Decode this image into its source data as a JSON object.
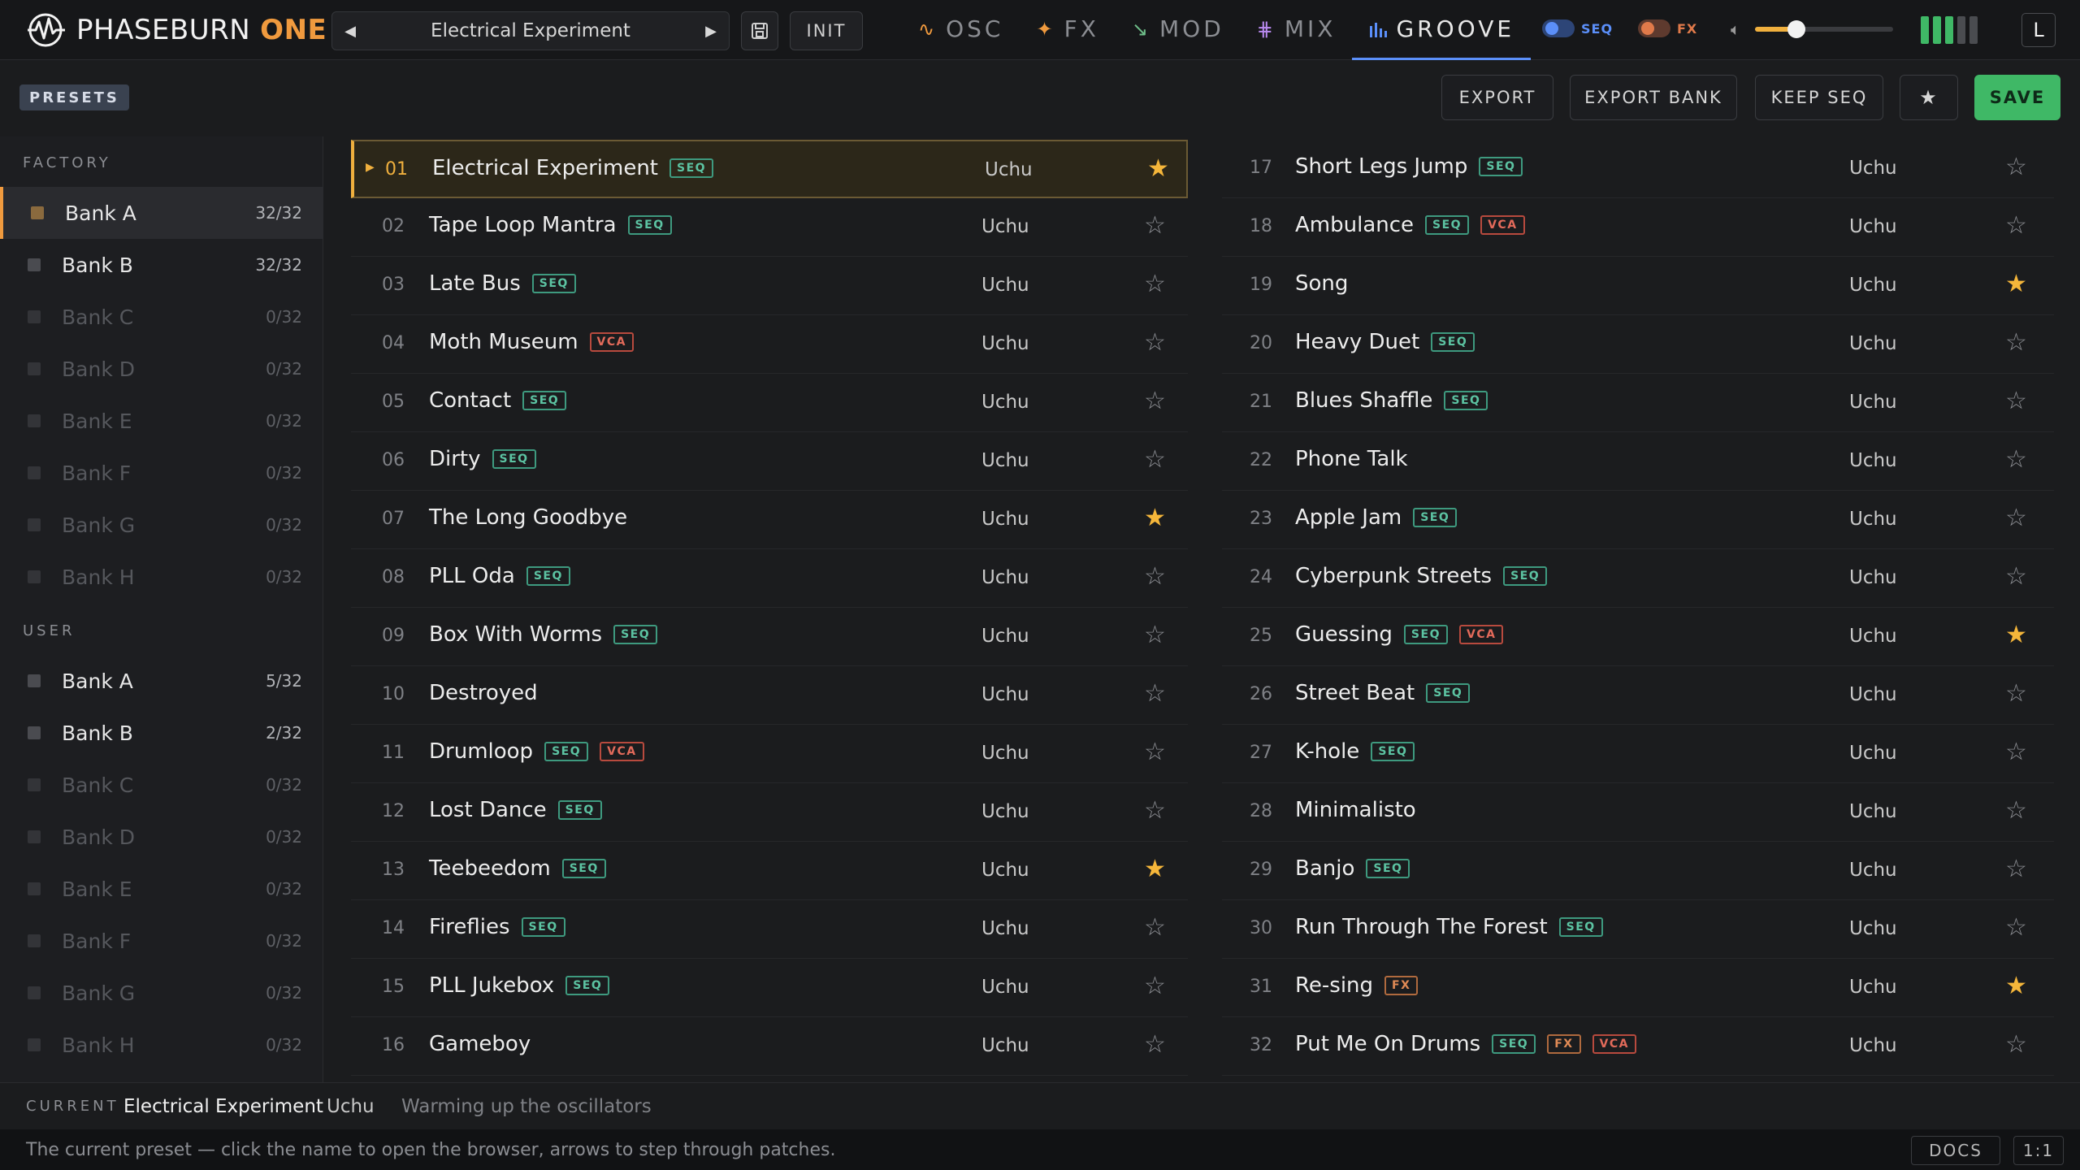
{
  "app": {
    "name": "PHASEBURN",
    "name_accent": "ONE"
  },
  "header": {
    "current_preset": "Electrical Experiment",
    "prev_icon": "triangle-left-icon",
    "next_icon": "triangle-right-icon",
    "save_icon": "floppy-disk-icon",
    "init_label": "INIT",
    "tabs": [
      {
        "label": "OSC",
        "icon": "wave-icon"
      },
      {
        "label": "FX",
        "icon": "sparkle-icon"
      },
      {
        "label": "MOD",
        "icon": "curve-icon"
      },
      {
        "label": "MIX",
        "icon": "faders-icon"
      },
      {
        "label": "GROOVE",
        "icon": "bars-icon",
        "active": true
      }
    ],
    "toggles": [
      {
        "label": "SEQ",
        "on": true,
        "color": "#5b8ff9"
      },
      {
        "label": "FX",
        "on": true,
        "color": "#e07a4a"
      }
    ],
    "volume_icon": "speaker-icon",
    "volume_level": 0.3,
    "meter_bars": [
      {
        "color": "#3fb866"
      },
      {
        "color": "#3fb866"
      },
      {
        "color": "#3fb866"
      },
      {
        "color": "#4a4c50"
      },
      {
        "color": "#4a4c50"
      }
    ],
    "layout_label": "L"
  },
  "toolbar": {
    "presets_label": "PRESETS",
    "export_label": "EXPORT",
    "export_bank_label": "EXPORT BANK",
    "keep_seq_label": "KEEP SEQ",
    "favorite_icon": "star-icon",
    "save_label": "SAVE"
  },
  "sidebar": {
    "factory_title": "FACTORY",
    "user_title": "USER",
    "factory_banks": [
      {
        "label": "Bank A",
        "count": "32/32",
        "active": true,
        "empty": false
      },
      {
        "label": "Bank B",
        "count": "32/32",
        "active": false,
        "empty": false
      },
      {
        "label": "Bank C",
        "count": "0/32",
        "active": false,
        "empty": true
      },
      {
        "label": "Bank D",
        "count": "0/32",
        "active": false,
        "empty": true
      },
      {
        "label": "Bank E",
        "count": "0/32",
        "active": false,
        "empty": true
      },
      {
        "label": "Bank F",
        "count": "0/32",
        "active": false,
        "empty": true
      },
      {
        "label": "Bank G",
        "count": "0/32",
        "active": false,
        "empty": true
      },
      {
        "label": "Bank H",
        "count": "0/32",
        "active": false,
        "empty": true
      }
    ],
    "user_banks": [
      {
        "label": "Bank A",
        "count": "5/32",
        "active": false,
        "empty": false
      },
      {
        "label": "Bank B",
        "count": "2/32",
        "active": false,
        "empty": false
      },
      {
        "label": "Bank C",
        "count": "0/32",
        "active": false,
        "empty": true
      },
      {
        "label": "Bank D",
        "count": "0/32",
        "active": false,
        "empty": true
      },
      {
        "label": "Bank E",
        "count": "0/32",
        "active": false,
        "empty": true
      },
      {
        "label": "Bank F",
        "count": "0/32",
        "active": false,
        "empty": true
      },
      {
        "label": "Bank G",
        "count": "0/32",
        "active": false,
        "empty": true
      },
      {
        "label": "Bank H",
        "count": "0/32",
        "active": false,
        "empty": true
      }
    ]
  },
  "presets": [
    {
      "num": "01",
      "name": "Electrical Experiment",
      "tags": [
        "SEQ"
      ],
      "author": "Uchu",
      "fav": true,
      "selected": true
    },
    {
      "num": "02",
      "name": "Tape Loop Mantra",
      "tags": [
        "SEQ"
      ],
      "author": "Uchu",
      "fav": false
    },
    {
      "num": "03",
      "name": "Late Bus",
      "tags": [
        "SEQ"
      ],
      "author": "Uchu",
      "fav": false
    },
    {
      "num": "04",
      "name": "Moth Museum",
      "tags": [
        "VCA"
      ],
      "author": "Uchu",
      "fav": false
    },
    {
      "num": "05",
      "name": "Contact",
      "tags": [
        "SEQ"
      ],
      "author": "Uchu",
      "fav": false
    },
    {
      "num": "06",
      "name": "Dirty",
      "tags": [
        "SEQ"
      ],
      "author": "Uchu",
      "fav": false
    },
    {
      "num": "07",
      "name": "The Long Goodbye",
      "tags": [],
      "author": "Uchu",
      "fav": true
    },
    {
      "num": "08",
      "name": "PLL Oda",
      "tags": [
        "SEQ"
      ],
      "author": "Uchu",
      "fav": false
    },
    {
      "num": "09",
      "name": "Box With Worms",
      "tags": [
        "SEQ"
      ],
      "author": "Uchu",
      "fav": false
    },
    {
      "num": "10",
      "name": "Destroyed",
      "tags": [],
      "author": "Uchu",
      "fav": false
    },
    {
      "num": "11",
      "name": "Drumloop",
      "tags": [
        "SEQ",
        "VCA"
      ],
      "author": "Uchu",
      "fav": false
    },
    {
      "num": "12",
      "name": "Lost Dance",
      "tags": [
        "SEQ"
      ],
      "author": "Uchu",
      "fav": false
    },
    {
      "num": "13",
      "name": "Teebeedom",
      "tags": [
        "SEQ"
      ],
      "author": "Uchu",
      "fav": true
    },
    {
      "num": "14",
      "name": "Fireflies",
      "tags": [
        "SEQ"
      ],
      "author": "Uchu",
      "fav": false
    },
    {
      "num": "15",
      "name": "PLL Jukebox",
      "tags": [
        "SEQ"
      ],
      "author": "Uchu",
      "fav": false
    },
    {
      "num": "16",
      "name": "Gameboy",
      "tags": [],
      "author": "Uchu",
      "fav": false
    },
    {
      "num": "17",
      "name": "Short Legs Jump",
      "tags": [
        "SEQ"
      ],
      "author": "Uchu",
      "fav": false
    },
    {
      "num": "18",
      "name": "Ambulance",
      "tags": [
        "SEQ",
        "VCA"
      ],
      "author": "Uchu",
      "fav": false
    },
    {
      "num": "19",
      "name": "Song",
      "tags": [],
      "author": "Uchu",
      "fav": true
    },
    {
      "num": "20",
      "name": "Heavy Duet",
      "tags": [
        "SEQ"
      ],
      "author": "Uchu",
      "fav": false
    },
    {
      "num": "21",
      "name": "Blues Shaffle",
      "tags": [
        "SEQ"
      ],
      "author": "Uchu",
      "fav": false
    },
    {
      "num": "22",
      "name": "Phone Talk",
      "tags": [],
      "author": "Uchu",
      "fav": false
    },
    {
      "num": "23",
      "name": "Apple Jam",
      "tags": [
        "SEQ"
      ],
      "author": "Uchu",
      "fav": false
    },
    {
      "num": "24",
      "name": "Cyberpunk Streets",
      "tags": [
        "SEQ"
      ],
      "author": "Uchu",
      "fav": false
    },
    {
      "num": "25",
      "name": "Guessing",
      "tags": [
        "SEQ",
        "VCA"
      ],
      "author": "Uchu",
      "fav": true
    },
    {
      "num": "26",
      "name": "Street Beat",
      "tags": [
        "SEQ"
      ],
      "author": "Uchu",
      "fav": false
    },
    {
      "num": "27",
      "name": "K-hole",
      "tags": [
        "SEQ"
      ],
      "author": "Uchu",
      "fav": false
    },
    {
      "num": "28",
      "name": "Minimalisto",
      "tags": [],
      "author": "Uchu",
      "fav": false
    },
    {
      "num": "29",
      "name": "Banjo",
      "tags": [
        "SEQ"
      ],
      "author": "Uchu",
      "fav": false
    },
    {
      "num": "30",
      "name": "Run Through The Forest",
      "tags": [
        "SEQ"
      ],
      "author": "Uchu",
      "fav": false
    },
    {
      "num": "31",
      "name": "Re-sing",
      "tags": [
        "FX"
      ],
      "author": "Uchu",
      "fav": true
    },
    {
      "num": "32",
      "name": "Put Me On Drums",
      "tags": [
        "SEQ",
        "FX",
        "VCA"
      ],
      "author": "Uchu",
      "fav": false
    }
  ],
  "status": {
    "current_label": "CURRENT",
    "preset_name": "Electrical Experiment",
    "author": "Uchu",
    "message": "Warming up the oscillators"
  },
  "hint": {
    "text": "The current preset — click the name to open the browser, arrows to step through patches.",
    "docs_label": "DOCS",
    "zoom_label": "1:1"
  }
}
